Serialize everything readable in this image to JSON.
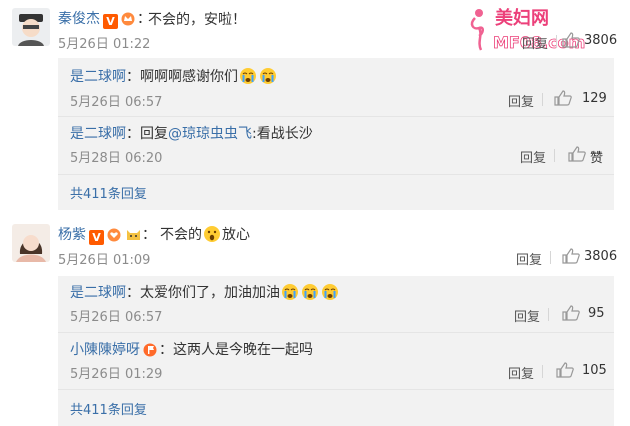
{
  "watermark": {
    "brand": "美妇网",
    "site": "MF08.com"
  },
  "comments": [
    {
      "user": "秦俊杰",
      "text": "不会的，安啦！",
      "time": "5月26日 01:22",
      "reply": "回复",
      "likes": "3806",
      "replies": [
        {
          "user": "是二球啊",
          "text": "啊啊啊感谢你们",
          "time": "5月26日 06:57",
          "reply": "回复",
          "likes": "129"
        },
        {
          "user": "是二球啊",
          "text_prefix": "回复",
          "mention": "@琼琼虫虫飞",
          "text_suffix": ":看战长沙",
          "time": "5月28日 06:20",
          "reply": "回复",
          "likes": "赞"
        }
      ],
      "more": "共411条回复"
    },
    {
      "user": "杨紫",
      "text_a": "不会的",
      "text_b": "放心",
      "time": "5月26日 01:09",
      "reply": "回复",
      "likes": "3806",
      "replies": [
        {
          "user": "是二球啊",
          "text": "太爱你们了，加油加油",
          "time": "5月26日 06:57",
          "reply": "回复",
          "likes": "95"
        },
        {
          "user": "小陳陳婷呀",
          "text": "这两人是今晚在一起吗",
          "time": "5月26日 01:29",
          "reply": "回复",
          "likes": "105"
        }
      ],
      "more": "共411条回复"
    }
  ]
}
